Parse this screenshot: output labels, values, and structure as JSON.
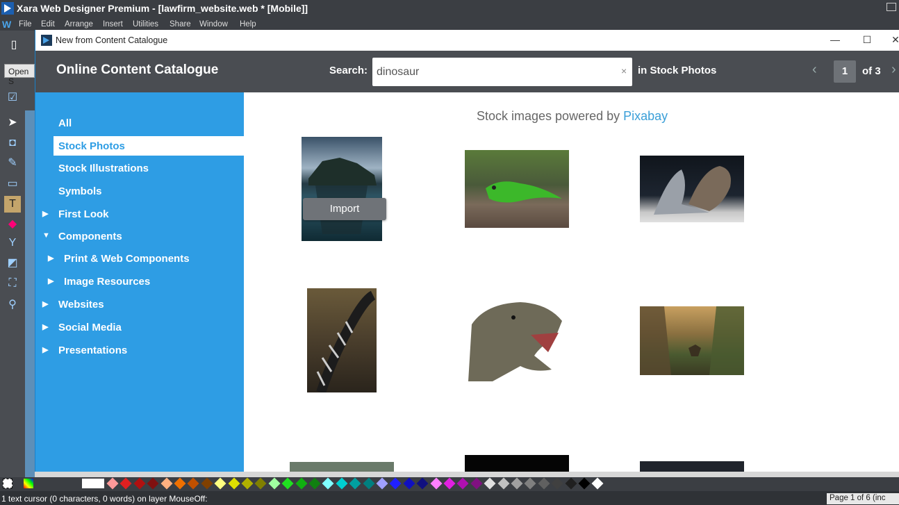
{
  "app": {
    "title": "Xara Web Designer Premium - [lawfirm_website.web * [Mobile]]",
    "menu": [
      "File",
      "Edit",
      "Arrange",
      "Insert",
      "Utilities",
      "Share",
      "Window",
      "Help"
    ],
    "menu_logo": "W",
    "open_button": "Open S"
  },
  "dialog": {
    "title": "New from Content Catalogue",
    "controls": {
      "minimize": "—",
      "maximize": "☐",
      "close": "✕"
    }
  },
  "header": {
    "catalogue_title": "Online Content Catalogue",
    "search_label": "Search:",
    "search_value": "dinosaur",
    "search_clear": "×",
    "search_scope": "in Stock Photos",
    "page_current": "1",
    "page_of": "of 3"
  },
  "sidebar": {
    "items": [
      {
        "label": "All",
        "active": false
      },
      {
        "label": "Stock Photos",
        "active": true
      },
      {
        "label": "Stock Illustrations",
        "active": false
      },
      {
        "label": "Symbols",
        "active": false
      },
      {
        "label": "First Look",
        "arrow": "▶"
      },
      {
        "label": "Components",
        "arrow": "▼"
      },
      {
        "label": "Print & Web Components",
        "arrow": "▶"
      },
      {
        "label": "Image Resources",
        "arrow": "▶"
      },
      {
        "label": "Websites",
        "arrow": "▶"
      },
      {
        "label": "Social Media",
        "arrow": "▶"
      },
      {
        "label": "Presentations",
        "arrow": "▶"
      }
    ]
  },
  "content": {
    "powered_prefix": "Stock images powered by ",
    "powered_link": "Pixabay",
    "import_label": "Import",
    "thumbnails": [
      "dinosaur-island-photo",
      "green-lizard-photo",
      "iguanas-photo",
      "dinosaur-skeleton-photo",
      "t-rex-head-photo",
      "prehistoric-valley-photo"
    ]
  },
  "status": {
    "text": "1 text cursor (0 characters, 0 words) on layer MouseOff:",
    "page": "Page 1 of 6 (inc"
  },
  "colors": {
    "header_bg": "#4a4d52",
    "sidebar_bg": "#2e9de4",
    "link": "#3a9fd8",
    "palette": [
      "#ff9999",
      "#e02020",
      "#b01010",
      "#801010",
      "#ffb080",
      "#f07000",
      "#c05000",
      "#804000",
      "#ffff80",
      "#e0e000",
      "#b0b000",
      "#808000",
      "#a0ffa0",
      "#20e020",
      "#10b010",
      "#108010",
      "#80ffff",
      "#00d0d0",
      "#00a0a0",
      "#008080",
      "#a0a0ff",
      "#2020ff",
      "#1010c0",
      "#101080",
      "#ff80ff",
      "#e020e0",
      "#b010b0",
      "#801080",
      "#e0e0e0",
      "#c0c0c0",
      "#a0a0a0",
      "#808080",
      "#606060",
      "#404040",
      "#202020",
      "#000000",
      "#ffffff"
    ]
  }
}
